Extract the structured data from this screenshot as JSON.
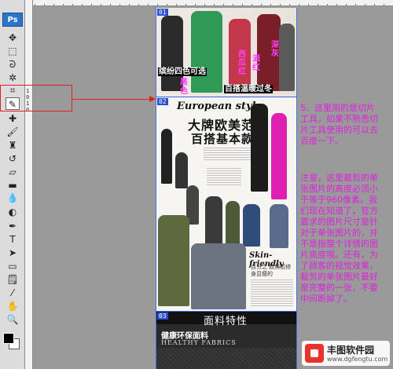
{
  "app": {
    "logo": "Ps"
  },
  "tools": [
    {
      "name": "move-tool-icon",
      "glyph": "✥"
    },
    {
      "name": "marquee-tool-icon",
      "glyph": "⬚"
    },
    {
      "name": "lasso-tool-icon",
      "glyph": "ᘒ"
    },
    {
      "name": "magic-wand-tool-icon",
      "glyph": "✲"
    },
    {
      "name": "crop-tool-icon",
      "glyph": "⌗"
    },
    {
      "name": "slice-tool-icon",
      "glyph": "✎"
    },
    {
      "name": "healing-brush-tool-icon",
      "glyph": "✚"
    },
    {
      "name": "brush-tool-icon",
      "glyph": "🖌"
    },
    {
      "name": "clone-stamp-tool-icon",
      "glyph": "♜"
    },
    {
      "name": "history-brush-tool-icon",
      "glyph": "↺"
    },
    {
      "name": "eraser-tool-icon",
      "glyph": "▱"
    },
    {
      "name": "gradient-tool-icon",
      "glyph": "▬"
    },
    {
      "name": "blur-tool-icon",
      "glyph": "💧"
    },
    {
      "name": "dodge-tool-icon",
      "glyph": "◐"
    },
    {
      "name": "pen-tool-icon",
      "glyph": "✒"
    },
    {
      "name": "type-tool-icon",
      "glyph": "T"
    },
    {
      "name": "path-selection-tool-icon",
      "glyph": "➤"
    },
    {
      "name": "shape-tool-icon",
      "glyph": "▭"
    },
    {
      "name": "notes-tool-icon",
      "glyph": "🗒"
    },
    {
      "name": "eyedropper-tool-icon",
      "glyph": "⁄"
    },
    {
      "name": "hand-tool-icon",
      "glyph": "✋"
    },
    {
      "name": "zoom-tool-icon",
      "glyph": "🔍"
    }
  ],
  "ruler": {
    "v_labels": [
      "1",
      "0",
      "1",
      "0"
    ]
  },
  "slices": [
    {
      "badge": "01"
    },
    {
      "badge": "02"
    },
    {
      "badge": "03"
    }
  ],
  "slice1": {
    "tags": [
      "缤纷四色可选",
      "黑色",
      "深灰",
      "西瓜红",
      "酒红",
      "百搭温暖过冬"
    ]
  },
  "slice2": {
    "title_en": "European style",
    "title_cn1": "大牌欧美范",
    "title_cn2": "百搭基本款",
    "subtitle": "Skin-friendly",
    "caption": "百分之 欧美范修身显瘦的 "
  },
  "slice3": {
    "section_title": "面料特性",
    "fabric_cn": "健康环保面料",
    "fabric_en": "HEALTHY FABRICS"
  },
  "annotations": {
    "note1": "5、这里用的是切片工具，如果不熟悉切片工具使用的可以去百度一下。",
    "note2": "注意，这里裁剪的单张图片的高度必须小于等于960像素。我们现在知道了，官方要求的图片尺寸是针对于单张图片的，并不是指整个详情的图片高度哦。还有，为了顾客的视觉效果，裁剪的单张图片最好是完整的一张，不要中间断掉了。"
  },
  "watermark": {
    "name": "丰图软件园",
    "url": "www.dgfengtu.com"
  },
  "colors": {
    "annotation_text": "#e020e0",
    "annotation_arrow": "#e02020",
    "slice_badge": "#2a4fd0",
    "watermark_logo": "#e8322b"
  }
}
